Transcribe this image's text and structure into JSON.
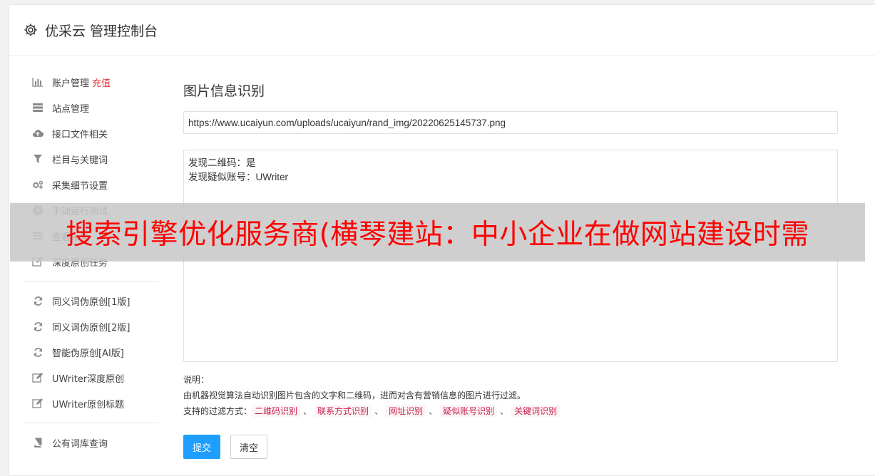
{
  "header": {
    "title": "优采云 管理控制台",
    "icon": "gear-icon"
  },
  "sidebar": {
    "group1": [
      {
        "label": "账户管理",
        "badge": "充值",
        "icon": "bar-chart-icon"
      },
      {
        "label": "站点管理",
        "icon": "server-icon"
      },
      {
        "label": "接口文件相关",
        "icon": "cloud-upload-icon"
      },
      {
        "label": "栏目与关键词",
        "icon": "filter-icon"
      },
      {
        "label": "采集细节设置",
        "icon": "gears-icon"
      },
      {
        "label": "手动运行测试",
        "icon": "play-circle-icon"
      },
      {
        "label": "查看采集",
        "icon": "list-icon"
      },
      {
        "label": "深度原创任务",
        "icon": "edit-icon"
      }
    ],
    "group2": [
      {
        "label": "同义词伪原创[1版]",
        "icon": "refresh-icon"
      },
      {
        "label": "同义词伪原创[2版]",
        "icon": "refresh-icon"
      },
      {
        "label": "智能伪原创[AI版]",
        "icon": "refresh-icon"
      },
      {
        "label": "UWriter深度原创",
        "icon": "edit-icon"
      },
      {
        "label": "UWriter原创标题",
        "icon": "edit-icon"
      }
    ],
    "group3": [
      {
        "label": "公有词库查询",
        "icon": "book-icon"
      }
    ]
  },
  "main": {
    "title": "图片信息识别",
    "url_value": "https://www.ucaiyun.com/uploads/ucaiyun/rand_img/20220625145737.png",
    "result_text": "发现二维码：是\n发现疑似账号：UWriter",
    "desc_label": "说明：",
    "desc_text": "由机器视觉算法自动识别图片包含的文字和二维码，进而对含有营销信息的图片进行过滤。",
    "filter_label": "支持的过滤方式：",
    "filters": [
      "二维码识别",
      "联系方式识别",
      "网址识别",
      "疑似账号识别",
      "关键词识别"
    ],
    "separator": "、",
    "submit_label": "提交",
    "clear_label": "清空"
  },
  "overlay": {
    "text": "搜索引擎优化服务商(横琴建站：中小企业在做网站建设时需"
  },
  "colors": {
    "primary": "#1e9fff",
    "badge": "#e4393c",
    "tag_text": "#c7254e",
    "overlay_text": "#ff0000"
  }
}
